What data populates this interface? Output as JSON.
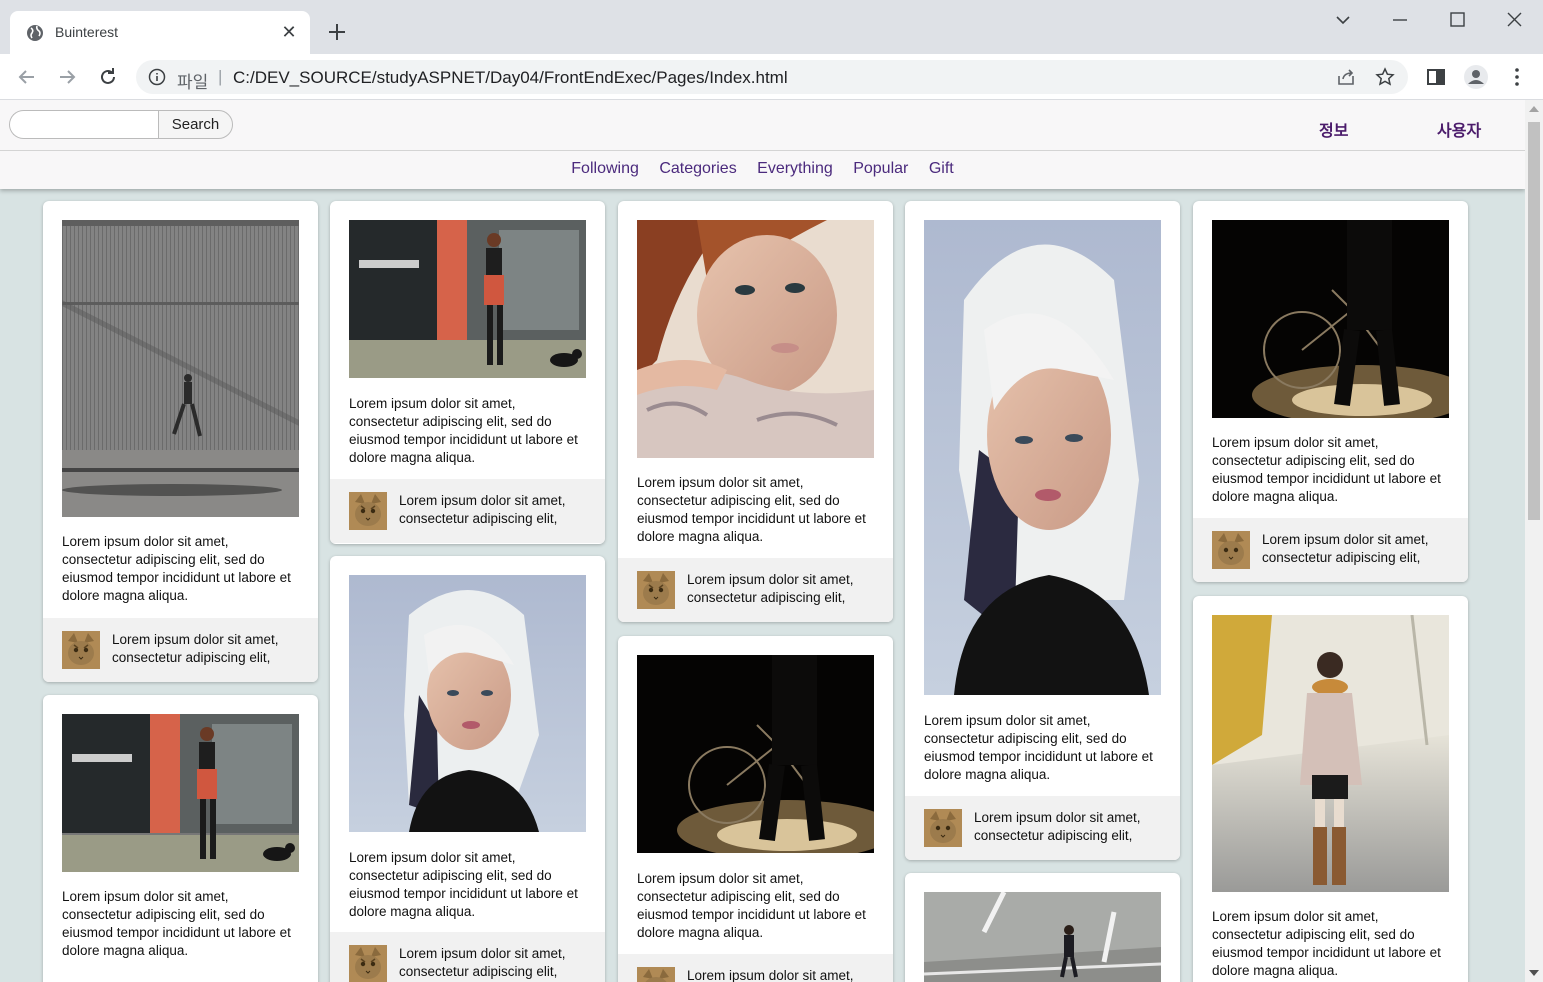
{
  "browser": {
    "tab_title": "Buinterest",
    "url_scheme_label": "파일",
    "url": "C:/DEV_SOURCE/studyASPNET/Day04/FrontEndExec/Pages/Index.html"
  },
  "header": {
    "search_placeholder": "",
    "search_button": "Search",
    "links": [
      "정보",
      "사용자"
    ],
    "nav": [
      "Following",
      "Categories",
      "Everything",
      "Popular",
      "Gift"
    ]
  },
  "card_text": {
    "description": "Lorem ipsum dolor sit amet, consectetur adipiscing elit, sed do eiusmod tempor incididunt ut labore et dolore magna aliqua.",
    "footer": "Lorem ipsum dolor sit amet, consectetur adipiscing elit,"
  },
  "cards": [
    {
      "column": 1,
      "image": "man-walking-by-grey-wall"
    },
    {
      "column": 1,
      "image": "woman-walking-dog"
    },
    {
      "column": 2,
      "image": "woman-walking-dog"
    },
    {
      "column": 2,
      "image": "white-haired-girl-portrait"
    },
    {
      "column": 3,
      "image": "woman-lying-portrait"
    },
    {
      "column": 3,
      "image": "bicycle-silhouette"
    },
    {
      "column": 4,
      "image": "white-haired-girl-portrait"
    },
    {
      "column": 4,
      "image": "man-on-street"
    },
    {
      "column": 5,
      "image": "bicycle-silhouette"
    },
    {
      "column": 5,
      "image": "woman-in-coat-on-road"
    }
  ],
  "colors": {
    "page_background": "#d8e3e3",
    "nav_link": "#4b2a7d",
    "top_link": "#4b1b6b"
  }
}
